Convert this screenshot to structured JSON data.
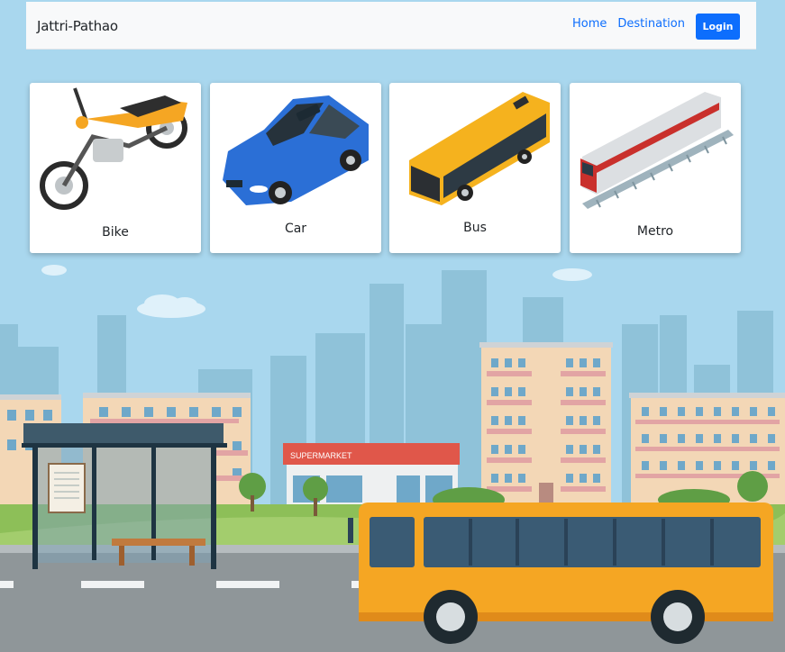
{
  "navbar": {
    "brand": "Jattri-Pathao",
    "links": [
      "Home",
      "Destination"
    ],
    "login_label": "Login"
  },
  "cards": [
    {
      "label": "Bike",
      "icon": "motorcycle-icon"
    },
    {
      "label": "Car",
      "icon": "car-icon"
    },
    {
      "label": "Bus",
      "icon": "bus-icon"
    },
    {
      "label": "Metro",
      "icon": "metro-train-icon"
    }
  ],
  "scene": {
    "shop_sign": "SUPERMARKET"
  },
  "colors": {
    "sky": "#a9d7ee",
    "primary": "#0d6efd",
    "bus": "#f5a623",
    "car": "#2b6fd6"
  }
}
